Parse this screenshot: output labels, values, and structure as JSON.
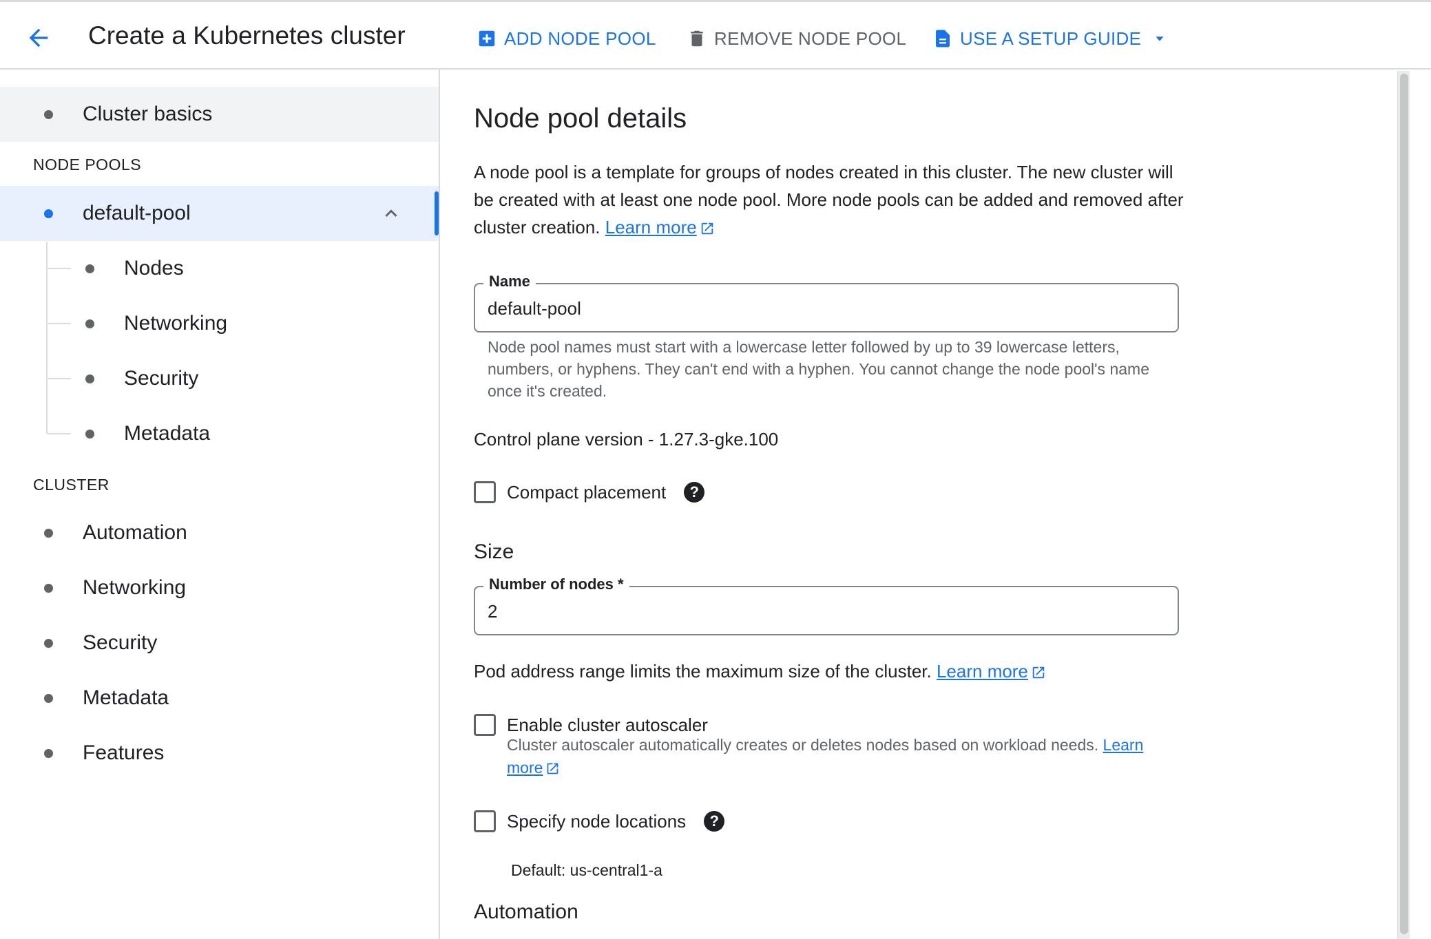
{
  "header": {
    "title": "Create a Kubernetes cluster",
    "add_node_pool": "ADD NODE POOL",
    "remove_node_pool": "REMOVE NODE POOL",
    "setup_guide": "USE A SETUP GUIDE"
  },
  "sidebar": {
    "cluster_basics": "Cluster basics",
    "node_pools_heading": "NODE POOLS",
    "pool": {
      "label": "default-pool",
      "children": [
        "Nodes",
        "Networking",
        "Security",
        "Metadata"
      ]
    },
    "cluster_heading": "CLUSTER",
    "cluster_items": [
      "Automation",
      "Networking",
      "Security",
      "Metadata",
      "Features"
    ]
  },
  "main": {
    "heading": "Node pool details",
    "intro": "A node pool is a template for groups of nodes created in this cluster. The new cluster will be created with at least one node pool. More node pools can be added and removed after cluster creation.",
    "learn_more": "Learn more",
    "name_field": {
      "label": "Name",
      "value": "default-pool",
      "hint": "Node pool names must start with a lowercase letter followed by up to 39 lowercase letters, numbers, or hyphens. They can't end with a hyphen. You cannot change the node pool's name once it's created."
    },
    "control_plane_version": "Control plane version - 1.27.3-gke.100",
    "compact_placement": {
      "label": "Compact placement",
      "checked": false
    },
    "size_heading": "Size",
    "nodes_field": {
      "label": "Number of nodes *",
      "value": "2"
    },
    "pod_range_text": "Pod address range limits the maximum size of the cluster.",
    "autoscaler": {
      "label": "Enable cluster autoscaler",
      "checked": false,
      "description": "Cluster autoscaler automatically creates or deletes nodes based on workload needs.",
      "learn_more": "Learn more"
    },
    "node_locations": {
      "label": "Specify node locations",
      "checked": false,
      "default": "Default: us-central1-a"
    },
    "automation_heading": "Automation"
  },
  "colors": {
    "accent": "#1a73e8",
    "text": "#202124",
    "muted": "#5f6368",
    "active_bg": "#e8f0fe",
    "shaded_bg": "#f1f3f4"
  },
  "icons": {
    "back": "arrow-back-icon",
    "add": "add-box-icon",
    "remove": "trash-icon",
    "guide": "document-icon",
    "dropdown": "caret-down-icon",
    "collapse": "chevron-up-icon",
    "help": "help-icon",
    "external": "external-link-icon"
  }
}
